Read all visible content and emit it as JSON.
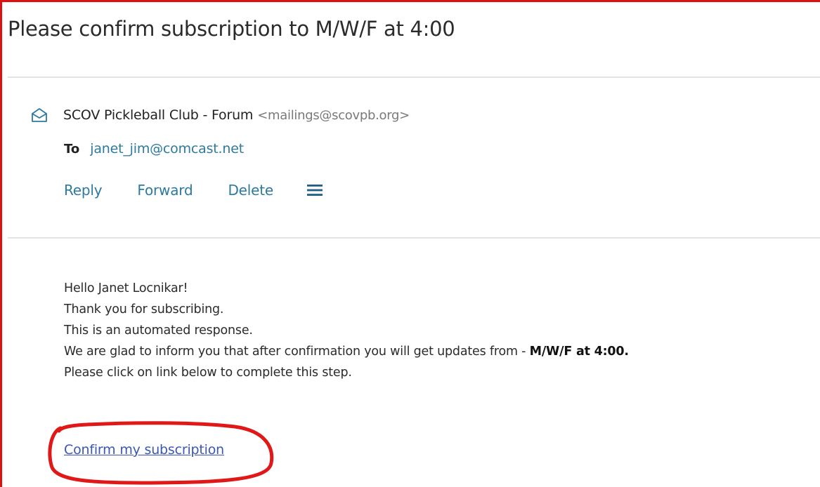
{
  "message": {
    "subject": "Please confirm subscription to M/W/F at 4:00",
    "sender_name": "SCOV Pickleball Club - Forum",
    "sender_email": "<mailings@scovpb.org>",
    "to_label": "To",
    "to_address": "janet_jim@comcast.net"
  },
  "actions": {
    "reply": "Reply",
    "forward": "Forward",
    "delete": "Delete",
    "menu_icon": "hamburger-menu-icon"
  },
  "body": {
    "line1": "Hello Janet Locnikar!",
    "line2": "Thank you for subscribing.",
    "line3": "This is an automated response.",
    "line4_prefix": "We are glad to inform you that after confirmation you will get updates from - ",
    "line4_bold": "M/W/F at 4:00.",
    "line5": "Please click on link below to complete this step.",
    "confirm_link": "Confirm my subscription"
  },
  "colors": {
    "frame_border": "#e01010",
    "link_teal": "#2d7a9e",
    "confirm_link_blue": "#3a57b5",
    "annotation_red": "#e01818"
  },
  "icons": {
    "sender": "open-envelope-icon"
  }
}
